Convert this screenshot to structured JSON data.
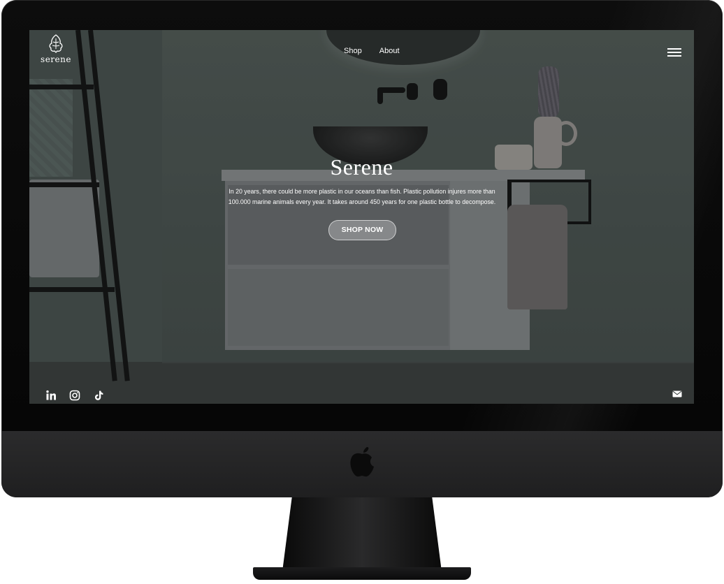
{
  "site": {
    "logo_text": "serene",
    "nav": [
      {
        "label": "Shop"
      },
      {
        "label": "About"
      }
    ]
  },
  "hero": {
    "title": "Serene",
    "body": "In 20 years, there could be more plastic in our oceans than fish. Plastic pollution injures more than 100.000 marine animals every year. It takes around 450 years for one plastic bottle to decompose.",
    "cta_label": "SHOP NOW"
  },
  "footer": {
    "social_icons": [
      "linkedin-icon",
      "instagram-icon",
      "tiktok-icon"
    ],
    "contact_icon": "mail-icon"
  },
  "colors": {
    "text": "#ffffff",
    "wall": "#4a5350",
    "bezel": "#0a0a0a",
    "chin": "#262627"
  }
}
